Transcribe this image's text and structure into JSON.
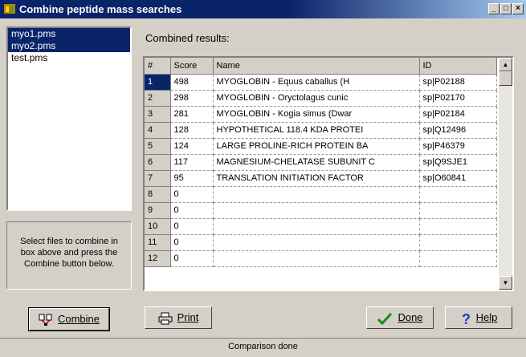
{
  "window": {
    "title": "Combine peptide mass searches"
  },
  "files": [
    {
      "name": "myo1.pms",
      "selected": true
    },
    {
      "name": "myo2.pms",
      "selected": true
    },
    {
      "name": "test.pms",
      "selected": false
    }
  ],
  "hint": "Select files to combine in box above and press the Combine button below.",
  "results": {
    "label": "Combined results:",
    "columns": [
      "#",
      "Score",
      "Name",
      "ID"
    ],
    "rows": [
      [
        "1",
        "498",
        "MYOGLOBIN - Equus caballus (H",
        "sp|P02188"
      ],
      [
        "2",
        "298",
        "MYOGLOBIN - Oryctolagus cunic",
        "sp|P02170"
      ],
      [
        "3",
        "281",
        "MYOGLOBIN - Kogia simus (Dwar",
        "sp|P02184"
      ],
      [
        "4",
        "128",
        "HYPOTHETICAL 118.4 KDA PROTEI",
        "sp|Q12496"
      ],
      [
        "5",
        "124",
        "LARGE PROLINE-RICH PROTEIN BA",
        "sp|P46379"
      ],
      [
        "6",
        "117",
        "MAGNESIUM-CHELATASE SUBUNIT C",
        "sp|Q9SJE1"
      ],
      [
        "7",
        "95",
        "TRANSLATION INITIATION FACTOR",
        "sp|O60841"
      ],
      [
        "8",
        "0",
        "",
        ""
      ],
      [
        "9",
        "0",
        "",
        ""
      ],
      [
        "10",
        "0",
        "",
        ""
      ],
      [
        "11",
        "0",
        "",
        ""
      ],
      [
        "12",
        "0",
        "",
        ""
      ]
    ]
  },
  "buttons": {
    "combine": "Combine",
    "print": "Print",
    "done": "Done",
    "help": "Help"
  },
  "status": "Comparison done",
  "colors": {
    "title_bar": "#0a246a",
    "selection": "#0a246a",
    "face": "#d4d0c8",
    "done_check": "#1a8a1a",
    "help_mark": "#1a3ccc"
  }
}
